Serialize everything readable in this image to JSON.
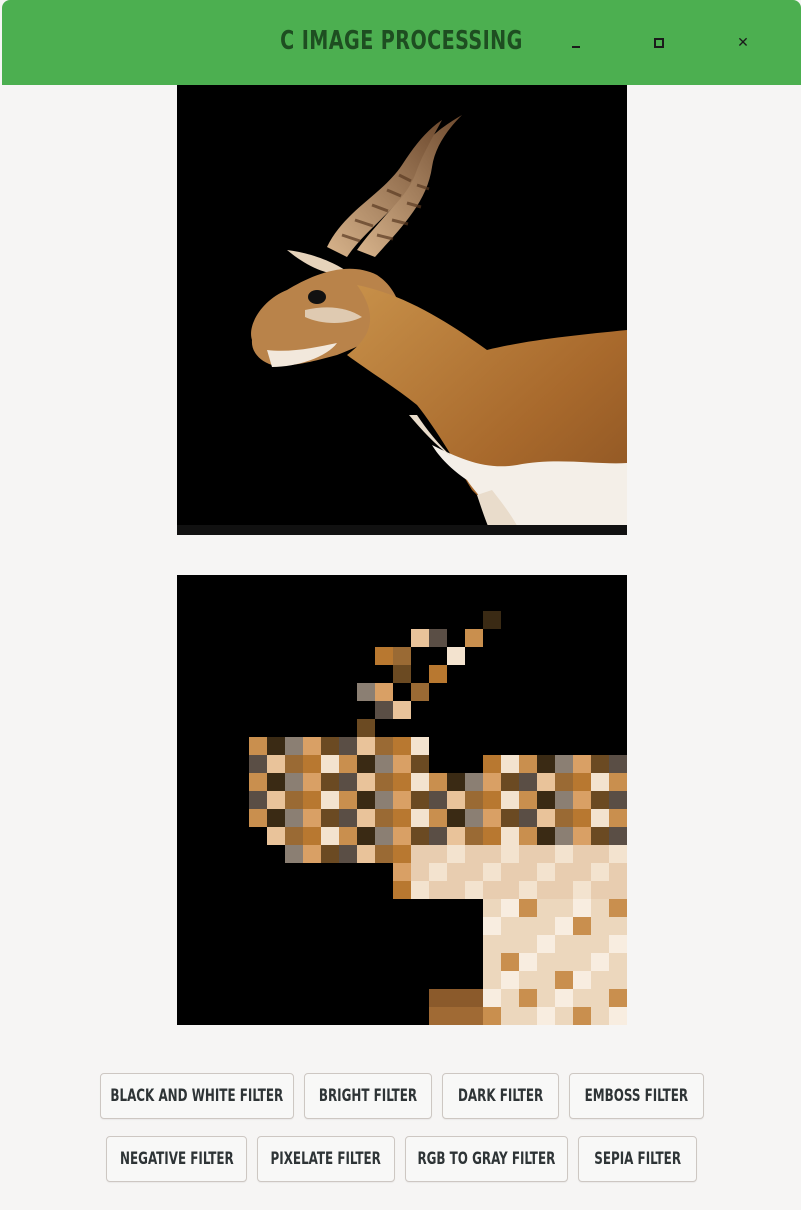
{
  "window": {
    "title": "C Image Processing",
    "controls": {
      "minimize_icon": "minimize-icon",
      "maximize_icon": "maximize-icon",
      "close_icon": "close-icon",
      "close_glyph": "✕"
    },
    "accent_color": "#4caf50"
  },
  "images": {
    "original": {
      "name": "antelope-original"
    },
    "processed": {
      "name": "antelope-pixelated"
    }
  },
  "filters": {
    "row1": [
      "Black and White Filter",
      "Bright Filter",
      "Dark Filter",
      "Emboss Filter"
    ],
    "row2": [
      "Negative Filter",
      "Pixelate Filter",
      "RGB to Gray Filter",
      "Sepia Filter"
    ]
  }
}
